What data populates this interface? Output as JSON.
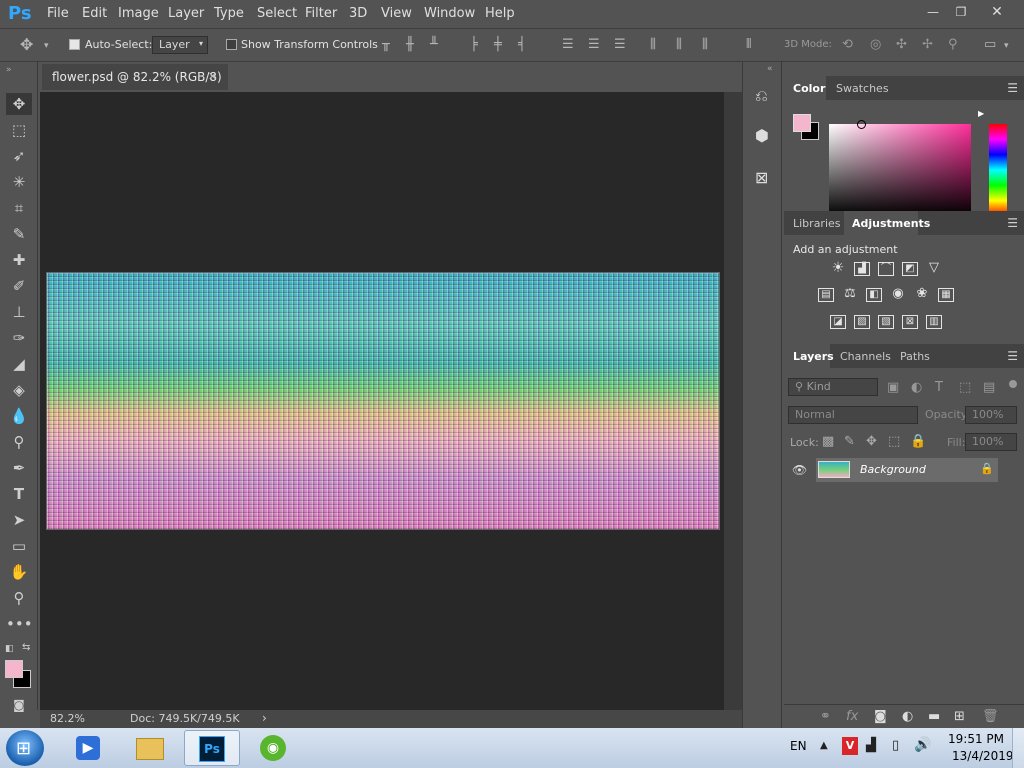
{
  "app": {
    "logo": "Ps"
  },
  "menu": [
    "File",
    "Edit",
    "Image",
    "Layer",
    "Type",
    "Select",
    "Filter",
    "3D",
    "View",
    "Window",
    "Help"
  ],
  "window_controls": {
    "minimize": "—",
    "restore": "❐",
    "close": "✕"
  },
  "options": {
    "auto_select_label": "Auto-Select:",
    "auto_select_checked": true,
    "target_value": "Layer",
    "show_transform_label": "Show Transform Controls",
    "mode_3d_label": "3D Mode:"
  },
  "document": {
    "tab_title": "flower.psd @ 82.2% (RGB/8)",
    "zoom": "82.2%",
    "doc_size": "Doc: 749.5K/749.5K"
  },
  "color_panel": {
    "tabs": [
      "Color",
      "Swatches"
    ],
    "foreground": "#f5b5cc",
    "background": "#000000"
  },
  "adjustments_panel": {
    "tabs": [
      "Libraries",
      "Adjustments"
    ],
    "heading": "Add an adjustment"
  },
  "layers_panel": {
    "tabs": [
      "Layers",
      "Channels",
      "Paths"
    ],
    "kind_placeholder": "Kind",
    "blend_mode": "Normal",
    "opacity_label": "Opacity:",
    "opacity_value": "100%",
    "lock_label": "Lock:",
    "fill_label": "Fill:",
    "fill_value": "100%",
    "layers": [
      {
        "name": "Background",
        "visible": true,
        "locked": true
      }
    ]
  },
  "taskbar": {
    "language": "EN",
    "time": "19:51 PM",
    "date": "13/4/2019"
  }
}
